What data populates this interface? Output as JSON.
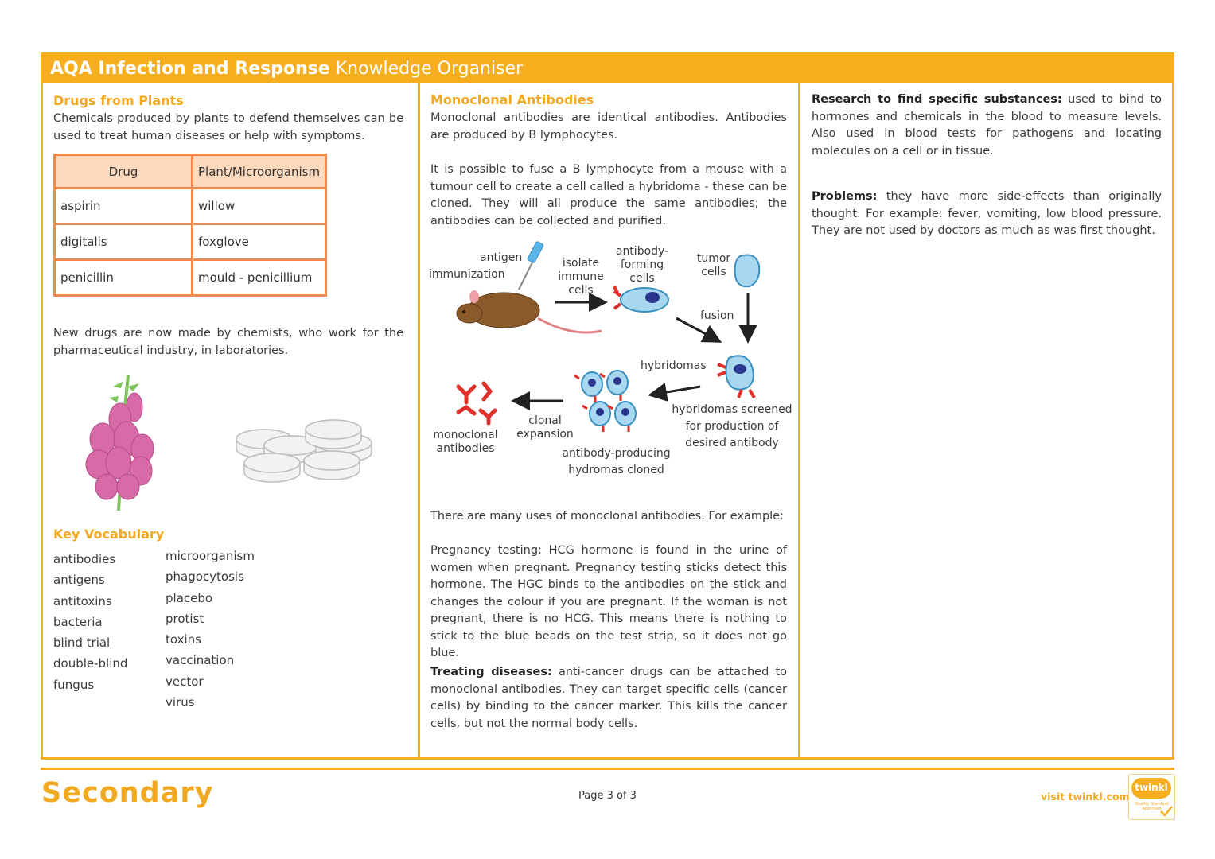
{
  "header": {
    "title_bold": "AQA Infection and Response",
    "title_light": "Knowledge Organiser"
  },
  "drugs_from_plants": {
    "heading": "Drugs from Plants",
    "intro": "Chemicals produced by plants to defend themselves can be used to treat human diseases or help with symptoms.",
    "table": {
      "headers": [
        "Drug",
        "Plant/Microorganism"
      ],
      "rows": [
        [
          "aspirin",
          "willow"
        ],
        [
          "digitalis",
          "foxglove"
        ],
        [
          "penicillin",
          "mould - penicillium"
        ]
      ]
    },
    "new_drugs": "New drugs are now made by chemists, who work for the pharmaceutical industry, in laboratories.",
    "images": [
      "foxglove-flower",
      "tablets"
    ]
  },
  "key_vocabulary": {
    "heading": "Key Vocabulary",
    "column1": [
      "antibodies",
      "antigens",
      "antitoxins",
      "bacteria",
      "blind trial",
      "double-blind",
      "fungus"
    ],
    "column2": [
      "microorganism",
      "phagocytosis",
      "placebo",
      "protist",
      "toxins",
      "vaccination",
      "vector",
      "virus"
    ]
  },
  "monoclonal": {
    "heading": "Monoclonal Antibodies",
    "para1": "Monoclonal antibodies are identical antibodies. Antibodies are produced by B lymphocytes.",
    "para2": "It is possible to fuse a B lymphocyte from a mouse with a tumour cell to create a cell called a hybridoma - these can be cloned. They will all produce the same antibodies; the antibodies can be collected and purified.",
    "diagram": {
      "antigen": "antigen",
      "immunization": "immunization",
      "isolate": "isolate immune cells",
      "antibody_forming": "antibody- forming cells",
      "tumor": "tumor cells",
      "fusion": "fusion",
      "hybridomas": "hybridomas",
      "screened": "hybridomas screened for production of desired antibody",
      "cloned": "antibody-producing hydromas cloned",
      "clonal": "clonal expansion",
      "monoclonal": "monoclonal antibodies"
    },
    "uses_intro": "There are many uses of monoclonal antibodies. For example:",
    "pregnancy": "Pregnancy testing: HCG hormone is found in the urine of women when pregnant. Pregnancy testing sticks detect this hormone. The HGC binds to the antibodies on the stick and changes the colour if you are pregnant. If the woman is not pregnant, there is no HCG. This means there is nothing to stick to the blue beads on the test strip, so it does not go blue.",
    "treating_label": "Treating diseases:",
    "treating_text": "anti-cancer drugs can be attached to monoclonal antibodies. They can target specific cells (cancer cells) by binding to the cancer marker. This kills the cancer cells, but not the normal body cells."
  },
  "column3": {
    "research_label": "Research to find specific substances:",
    "research_text": "used to bind to hormones and chemicals in the blood to measure levels. Also used in blood tests for pathogens and locating molecules on a cell or in tissue.",
    "problems_label": "Problems:",
    "problems_text": "they have more side-effects than originally thought. For example: fever, vomiting, low blood pressure. They are not used by doctors as much as was first thought."
  },
  "footer": {
    "brand": "Secondary",
    "page": "Page 3 of 3",
    "visit": "visit twinkl.com",
    "badge_logo": "twinkl",
    "badge_text": "Quality Standard Approved"
  },
  "colors": {
    "accent": "#f6ae1f",
    "heading": "#f2a922",
    "table_border": "#ef8a4e",
    "table_header_bg": "#fcd9bd"
  }
}
